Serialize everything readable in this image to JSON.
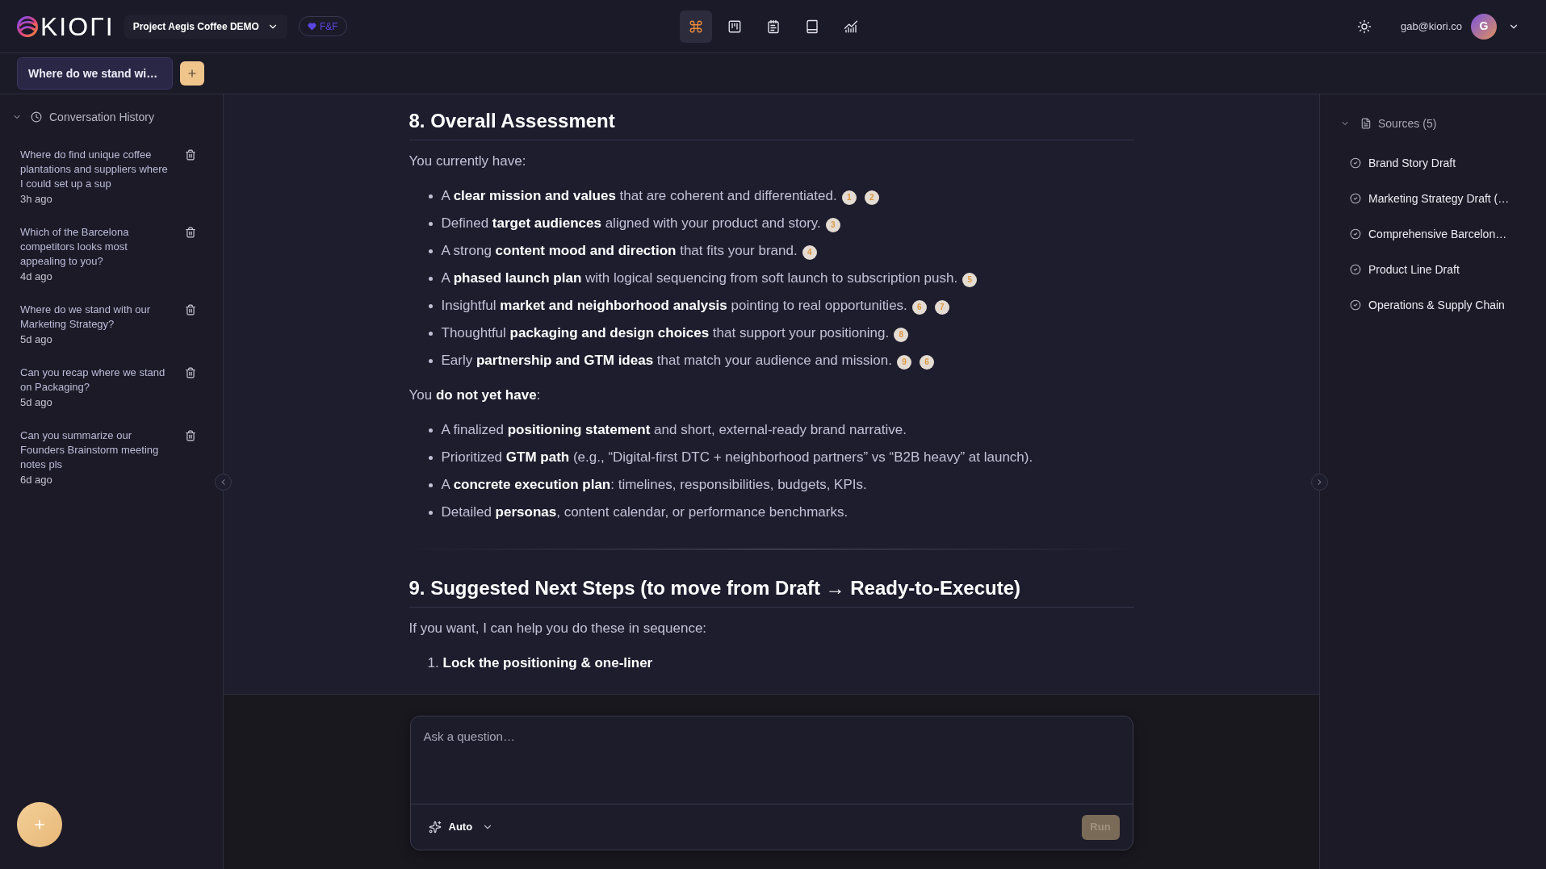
{
  "header": {
    "logo": {
      "text": "KIOΓI"
    },
    "project": {
      "label": "Project Aegis Coffee DEMO"
    },
    "plan": {
      "label": "F&F"
    },
    "nav": [
      {
        "selected": true
      },
      {
        "selected": false
      },
      {
        "selected": false
      },
      {
        "selected": false
      },
      {
        "selected": false
      }
    ],
    "user": {
      "email": "gab@kiori.co",
      "initial": "G"
    }
  },
  "tabs": [
    {
      "label": "Where do we stand wi…",
      "selected": true
    }
  ],
  "history": {
    "title": "Conversation History",
    "expanded": true,
    "items": [
      {
        "text": "Where do find unique coffee plantations and suppliers where I could set up a sup",
        "time": "3h ago"
      },
      {
        "text": "Which of the Barcelona competitors looks most appealing to you?",
        "time": "4d ago"
      },
      {
        "text": "Where do we stand with our Marketing Strategy?",
        "time": "5d ago"
      },
      {
        "text": "Can you recap where we stand on Packaging?",
        "time": "5d ago"
      },
      {
        "text": "Can you summarize our Founders Brainstorm meeting notes pls",
        "time": "6d ago"
      }
    ]
  },
  "content": {
    "sections": [
      {
        "heading": "8. Overall Assessment",
        "blocks": [
          {
            "kind": "paragraph",
            "text": "You currently have:"
          },
          {
            "kind": "bullets",
            "items": [
              {
                "text": "A **clear mission and values** that are coherent and differentiated.",
                "citations": [
                  "1",
                  "2"
                ]
              },
              {
                "text": "Defined **target audiences** aligned with your product and story.",
                "citations": [
                  "3"
                ]
              },
              {
                "text": "A strong **content mood and direction** that fits your brand.",
                "citations": [
                  "4"
                ]
              },
              {
                "text": "A **phased launch plan** with logical sequencing from soft launch to subscription push.",
                "citations": [
                  "5"
                ]
              },
              {
                "text": "Insightful **market and neighborhood analysis** pointing to real opportunities.",
                "citations": [
                  "6",
                  "7"
                ]
              },
              {
                "text": "Thoughtful **packaging and design choices** that support your positioning.",
                "citations": [
                  "8"
                ]
              },
              {
                "text": "Early **partnership and GTM ideas** that match your audience and mission.",
                "citations": [
                  "9",
                  "6"
                ]
              }
            ]
          },
          {
            "kind": "paragraph",
            "text": "You **do not yet have**:"
          },
          {
            "kind": "bullets",
            "items": [
              {
                "text": "A finalized **positioning statement** and short, external-ready brand narrative."
              },
              {
                "text": "Prioritized **GTM path** (e.g., “Digital-first DTC + neighborhood partners” vs “B2B heavy” at launch)."
              },
              {
                "text": "A **concrete execution plan**: timelines, responsibilities, budgets, KPIs."
              },
              {
                "text": "Detailed **personas**, content calendar, or performance benchmarks."
              }
            ]
          }
        ]
      },
      {
        "heading": "9. Suggested Next Steps (to move from Draft → Ready-to-Execute)",
        "blocks": [
          {
            "kind": "paragraph",
            "text": "If you want, I can help you do these in sequence:"
          },
          {
            "kind": "numbered",
            "items": [
              {
                "number": "1.",
                "text": "Lock the positioning & one-liner"
              }
            ]
          }
        ]
      }
    ]
  },
  "composer": {
    "placeholder": "Ask a question…",
    "mode": "Auto",
    "run_label": "Run",
    "run_disabled": true
  },
  "sources": {
    "title": "Sources (5)",
    "expanded": true,
    "items": [
      {
        "label": "Brand Story Draft",
        "checked": true
      },
      {
        "label": "Marketing Strategy Draft (…",
        "checked": true
      },
      {
        "label": "Comprehensive Barcelon…",
        "checked": true
      },
      {
        "label": "Product Line Draft",
        "checked": true
      },
      {
        "label": "Operations & Supply Chain",
        "checked": true
      }
    ]
  }
}
